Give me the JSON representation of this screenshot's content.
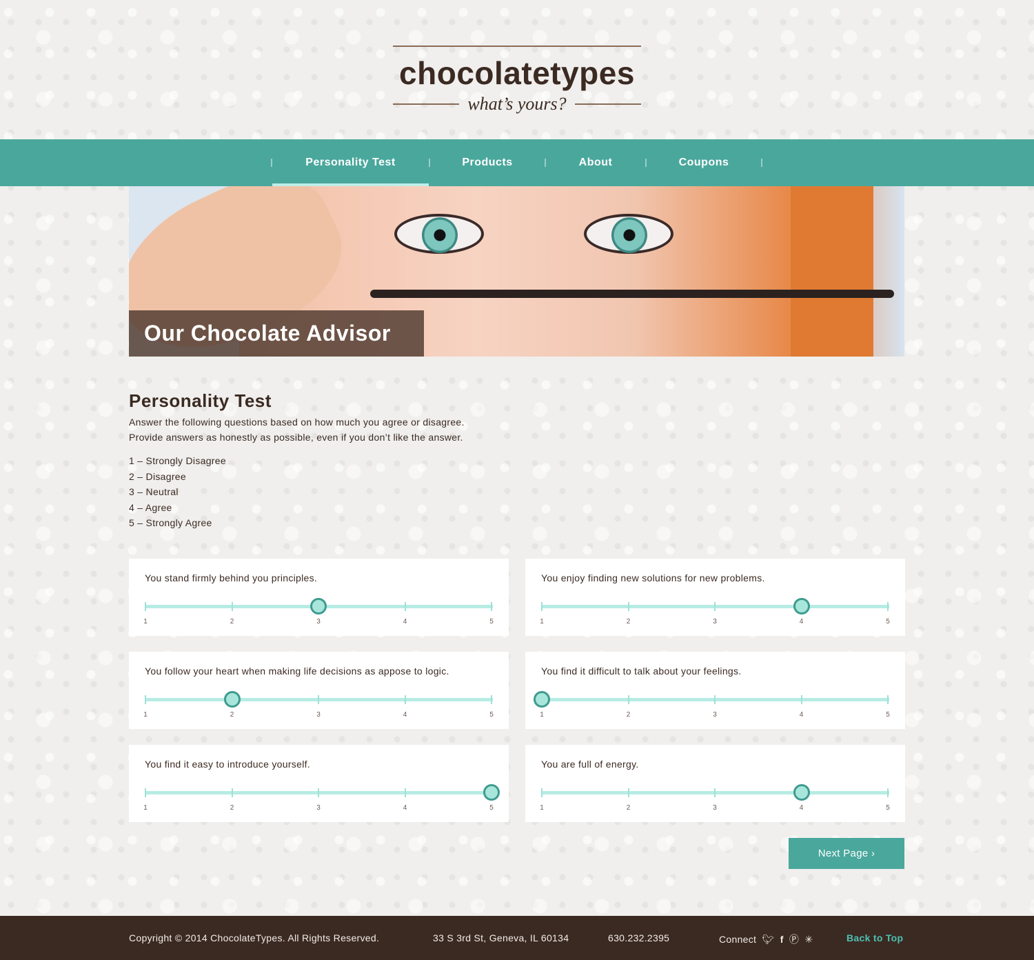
{
  "brand": {
    "logo": "chocolatetypes",
    "tagline": "what’s yours?"
  },
  "nav": {
    "items": [
      {
        "label": "Personality Test",
        "active": true
      },
      {
        "label": "Products",
        "active": false
      },
      {
        "label": "About",
        "active": false
      },
      {
        "label": "Coupons",
        "active": false
      }
    ]
  },
  "hero": {
    "caption": "Our Chocolate Advisor"
  },
  "intro": {
    "title": "Personality Test",
    "line1": "Answer the following questions based on how much you agree or disagree.",
    "line2": "Provide answers as honestly as possible, even if you don’t like the answer.",
    "scale": [
      "1 – Strongly Disagree",
      "2 – Disagree",
      "3 – Neutral",
      "4 – Agree",
      "5 – Strongly Agree"
    ]
  },
  "questions": [
    {
      "text": "You stand firmly behind you principles.",
      "value": 3
    },
    {
      "text": "You enjoy finding new solutions for new problems.",
      "value": 4
    },
    {
      "text": "You follow your heart when making life decisions as appose to logic.",
      "value": 2
    },
    {
      "text": "You find it difficult to talk about your feelings.",
      "value": 1
    },
    {
      "text": "You find it easy to introduce yourself.",
      "value": 5
    },
    {
      "text": "You are full of energy.",
      "value": 4
    }
  ],
  "scale_labels": [
    "1",
    "2",
    "3",
    "4",
    "5"
  ],
  "next_button": "Next Page ›",
  "footer": {
    "copyright": "Copyright © 2014 ChocolateTypes. All Rights Reserved.",
    "address": "33 S 3rd St, Geneva, IL 60134",
    "phone": "630.232.2395",
    "connect": "Connect",
    "back_to_top": "Back to Top"
  },
  "colors": {
    "accent": "#4aa79c",
    "brown": "#3b2a22",
    "track": "#b7ece4"
  }
}
